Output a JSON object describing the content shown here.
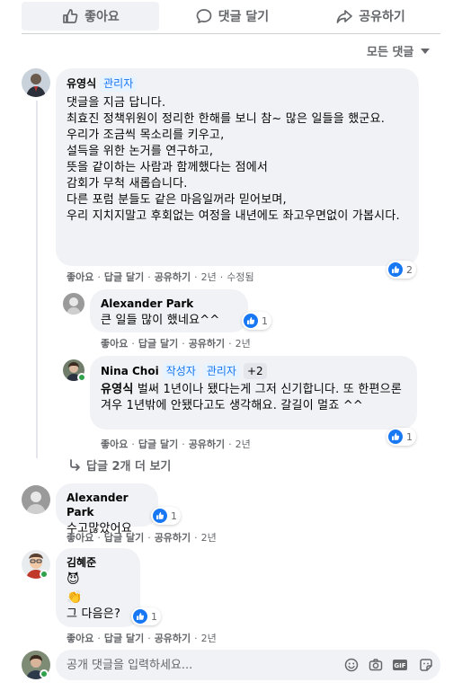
{
  "actions": {
    "like_label": "좋아요",
    "comment_label": "댓글 달기",
    "share_label": "공유하기"
  },
  "sort": {
    "label": "모든 댓글"
  },
  "comments": [
    {
      "author": "유영식",
      "badges": [
        "관리자"
      ],
      "text": "댓글을 지금 답니다.\n최효진 정책위원이 정리한 한해를 보니 참~ 많은 일들을 했군요.\n우리가 조금씩 목소리를 키우고,\n설득을 위한 논거를 연구하고,\n뜻을 같이하는 사람과 함께했다는 점에서\n감회가 무척 새롭습니다.\n다른 포럼 분들도 같은 마음일꺼라 믿어보며,\n우리 지치지말고 후회없는 여정을 내년에도 좌고우면없이 가봅시다.",
      "like": "좋아요",
      "reply": "답글 달기",
      "share": "공유하기",
      "age": "2년",
      "edited": "수정됨",
      "reactions": "2"
    },
    {
      "author": "Alexander Park",
      "text": "큰 일들 많이 했네요^^",
      "like": "좋아요",
      "reply": "답글 달기",
      "share": "공유하기",
      "age": "2년",
      "reactions": "1"
    },
    {
      "author": "Nina Choi",
      "badges": [
        "작성자",
        "관리자",
        "+2"
      ],
      "mention": "유영식",
      "text": " 벌써 1년이나 됐다는게 그저 신기합니다. 또 한편으론 겨우 1년밖에 안됐다고도 생각해요. 갈길이 멀죠 ^^",
      "like": "좋아요",
      "reply": "답글 달기",
      "share": "공유하기",
      "age": "2년",
      "reactions": "1"
    },
    {
      "author": "Alexander Park",
      "text": "수고많았어요",
      "like": "좋아요",
      "reply": "답글 달기",
      "share": "공유하기",
      "age": "2년",
      "reactions": "1"
    },
    {
      "author": "김혜준",
      "emoji1": "😈",
      "emoji2": "👏",
      "text": "그 다음은?",
      "like": "좋아요",
      "reply": "답글 달기",
      "share": "공유하기",
      "age": "2년",
      "reactions": "1"
    }
  ],
  "more_replies": "답글 2개 더 보기",
  "composer": {
    "placeholder": "공개 댓글을 입력하세요..."
  },
  "icons": [
    "like-icon",
    "comment-icon",
    "share-icon",
    "reply-arrow-icon",
    "emoji-icon",
    "camera-icon",
    "gif-icon",
    "sticker-icon"
  ],
  "colors": {
    "accent": "#1877f2",
    "bubble": "#f0f2f5",
    "muted": "#65676b",
    "online": "#31a24c"
  }
}
